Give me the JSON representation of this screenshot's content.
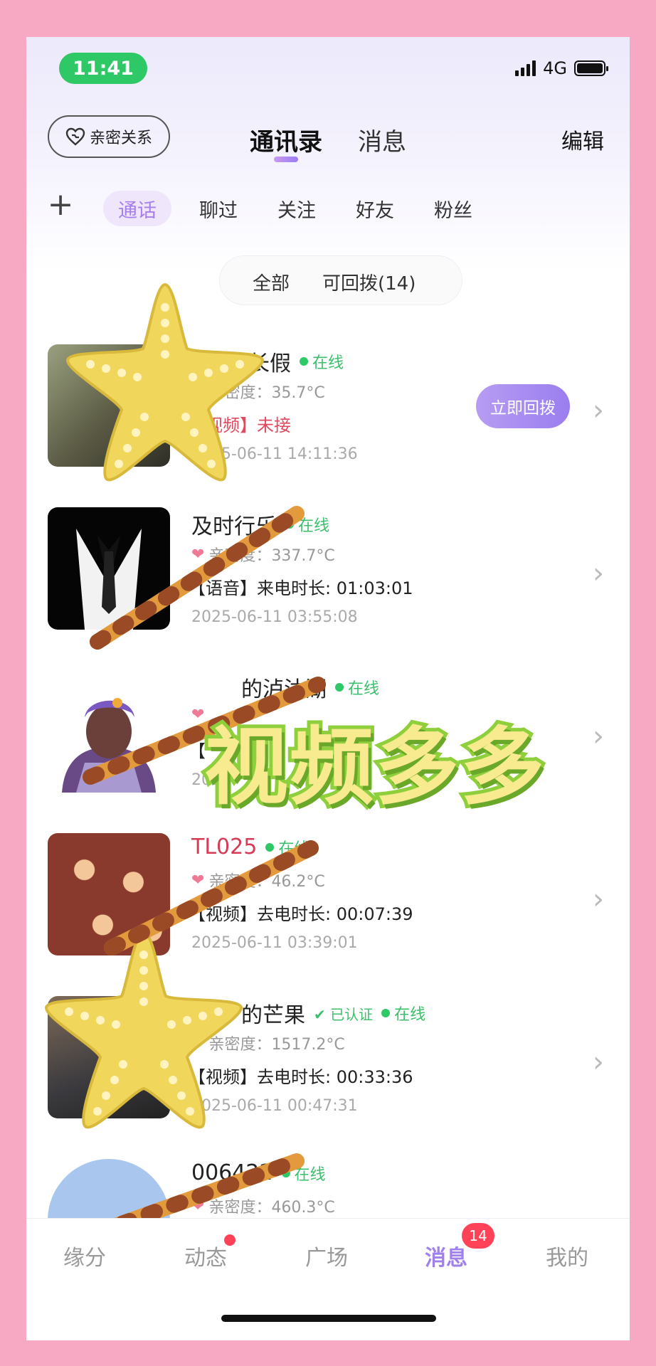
{
  "status_bar": {
    "time": "11:41",
    "network": "4G"
  },
  "header": {
    "intimacy_button": "亲密关系",
    "tabs": [
      {
        "label": "通讯录",
        "active": true
      },
      {
        "label": "消息",
        "active": false
      }
    ],
    "edit": "编辑"
  },
  "filter_tabs": [
    {
      "label": "通话",
      "active": true
    },
    {
      "label": "聊过",
      "active": false
    },
    {
      "label": "关注",
      "active": false
    },
    {
      "label": "好友",
      "active": false
    },
    {
      "label": "粉丝",
      "active": false
    }
  ],
  "segment": {
    "all": "全部",
    "callback": "可回拨(14)"
  },
  "contacts": [
    {
      "name": "长假",
      "online": "在线",
      "intimacy": "亲密度：35.7°C",
      "call": "【视频】未接",
      "missed": true,
      "time": "2025-06-11 14:11:36",
      "action": "立即回拨"
    },
    {
      "name": "及时行乐",
      "online": "在线",
      "intimacy": "亲密度：337.7°C",
      "call": "【语音】来电时长: 01:03:01",
      "missed": false,
      "time": "2025-06-11 03:55:08"
    },
    {
      "name": "的泸沽湖",
      "online": "在线",
      "intimacy": "",
      "call": "【",
      "missed": false,
      "time": "202"
    },
    {
      "name": "TL025",
      "online": "在线",
      "intimacy": "亲密度：46.2°C",
      "call": "【视频】去电时长: 00:07:39",
      "missed": false,
      "time": "2025-06-11 03:39:01"
    },
    {
      "name": "的芒果",
      "verified": "已认证",
      "online": "在线",
      "intimacy": "亲密度：1517.2°C",
      "call": "【视频】去电时长: 00:33:36",
      "missed": false,
      "time": "2025-06-11 00:47:31"
    },
    {
      "name": "006422",
      "online": "在线",
      "intimacy": "亲密度：460.3°C",
      "call": "",
      "missed": false,
      "time": ""
    }
  ],
  "tabbar": {
    "items": [
      {
        "label": "缘分",
        "active": false
      },
      {
        "label": "动态",
        "active": false,
        "dot": true
      },
      {
        "label": "广场",
        "active": false
      },
      {
        "label": "消息",
        "active": true,
        "badge": "14"
      },
      {
        "label": "我的",
        "active": false
      }
    ]
  },
  "watermark": "视频多多",
  "colors": {
    "accent": "#a67ef0",
    "online": "#2ec866",
    "missed": "#e0495e",
    "badge": "#ff4257",
    "frame": "#f7a9c4"
  }
}
